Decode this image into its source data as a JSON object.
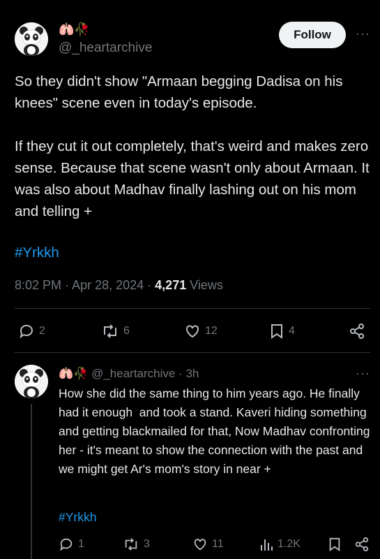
{
  "main_tweet": {
    "emoji": "🫁🥀",
    "handle": "@_heartarchive",
    "follow_label": "Follow",
    "more_label": "···",
    "text": "So they didn't show \"Armaan begging Dadisa on his knees\" scene even in today's episode.\n\nIf they cut it out completely, that's weird and makes zero sense. Because that scene wasn't only about Armaan. It was also about Madhav finally lashing out on his mom and telling +",
    "hashtag": "#Yrkkh",
    "time": "8:02 PM",
    "date": "Apr 28, 2024",
    "views_count": "4,271",
    "views_label": "Views",
    "actions": {
      "replies": "2",
      "reposts": "6",
      "likes": "12",
      "bookmarks": "4"
    }
  },
  "reply_tweet": {
    "emoji": "🫁🥀",
    "handle": "@_heartarchive",
    "age": "3h",
    "more_label": "···",
    "text": "How she did the same thing to him years ago. He finally had it enough  and took a stand. Kaveri hiding something and getting blackmailed for that, Now Madhav confronting her - it's meant to show the connection with the past and we might get Ar's mom's story in near +",
    "hashtag": "#Yrkkh",
    "actions": {
      "replies": "1",
      "reposts": "3",
      "likes": "11",
      "views": "1.2K"
    }
  },
  "colors": {
    "background": "#000000",
    "text": "#e7e9ea",
    "muted": "#71767b",
    "link": "#1d9bf0"
  },
  "icons": [
    "panda-avatar",
    "reply-icon",
    "repost-icon",
    "like-icon",
    "bookmark-icon",
    "share-icon",
    "views-icon"
  ]
}
